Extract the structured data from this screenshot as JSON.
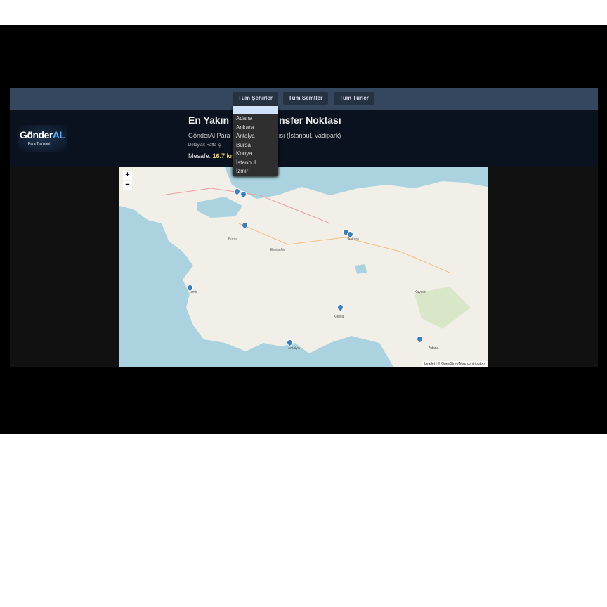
{
  "filters": {
    "city": "Tüm Şehirler",
    "district": "Tüm Semtler",
    "type": "Tüm Türler"
  },
  "city_options": [
    "Adana",
    "Ankara",
    "Antalya",
    "Bursa",
    "Konya",
    "İstanbul",
    "İzmir"
  ],
  "logo": {
    "name_a": "Gönder",
    "name_b": "AL",
    "tagline": "Para Transferi"
  },
  "result": {
    "title_left": "En Yakın",
    "title_right": "nsfer Noktası",
    "name_left": "GönderAl Para",
    "name_right": "ısı (İstanbul, Vadipark)",
    "details": "Detaylar: Hafta içi",
    "distance_label": "Mesafe:",
    "distance_value": "16.7 km"
  },
  "map": {
    "zoom_in": "+",
    "zoom_out": "−",
    "attribution": "Leaflet | © OpenStreetMap contributors",
    "labels": [
      "Bursa",
      "Ankara",
      "İzmir",
      "Konya",
      "Antalya",
      "Adana",
      "Eskişehir",
      "Kayseri"
    ]
  },
  "colors": {
    "accent": "#f5d76e",
    "nav": "#34475f"
  }
}
